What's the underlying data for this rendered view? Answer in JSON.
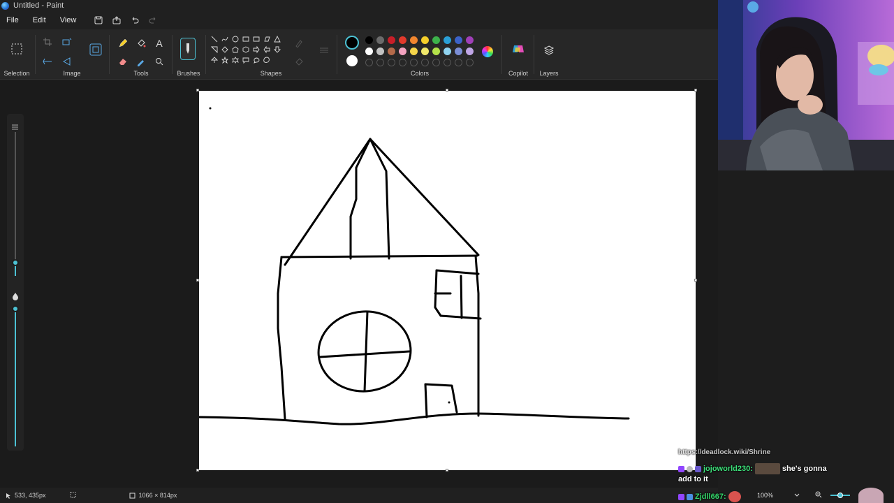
{
  "window": {
    "title": "Untitled - Paint"
  },
  "menu": {
    "file": "File",
    "edit": "Edit",
    "view": "View"
  },
  "ribbon": {
    "selection": "Selection",
    "image": "Image",
    "tools": "Tools",
    "brushes": "Brushes",
    "shapes": "Shapes",
    "colors": "Colors",
    "copilot": "Copilot",
    "layers": "Layers"
  },
  "palette": {
    "row1": [
      "#000000",
      "#6b6b6b",
      "#c81e28",
      "#e23a2c",
      "#f2862f",
      "#f5cf2a",
      "#3db24b",
      "#2a9fd6",
      "#3c63c9",
      "#a03fb8"
    ],
    "row2": [
      "#ffffff",
      "#c3c3c3",
      "#b46a4a",
      "#f4a3c0",
      "#f7d64b",
      "#f0e86a",
      "#b4e24a",
      "#8fd3f0",
      "#7b8ed6",
      "#c0a6e6"
    ]
  },
  "status": {
    "cursor_pos": "533, 435px",
    "canvas_size": "1066 × 814px",
    "zoom": "100%"
  },
  "chat": {
    "line0": "https://deadlock.wiki/Shrine",
    "line1_user": "jojoworld230:",
    "line1_msg": "she's gonna",
    "line2": "add to it",
    "line3_user": "Zjdll667:"
  },
  "colors": {
    "accent": "#4cc2d4",
    "chat_user1": "#3de07a",
    "chat_user2": "#34d66a"
  }
}
